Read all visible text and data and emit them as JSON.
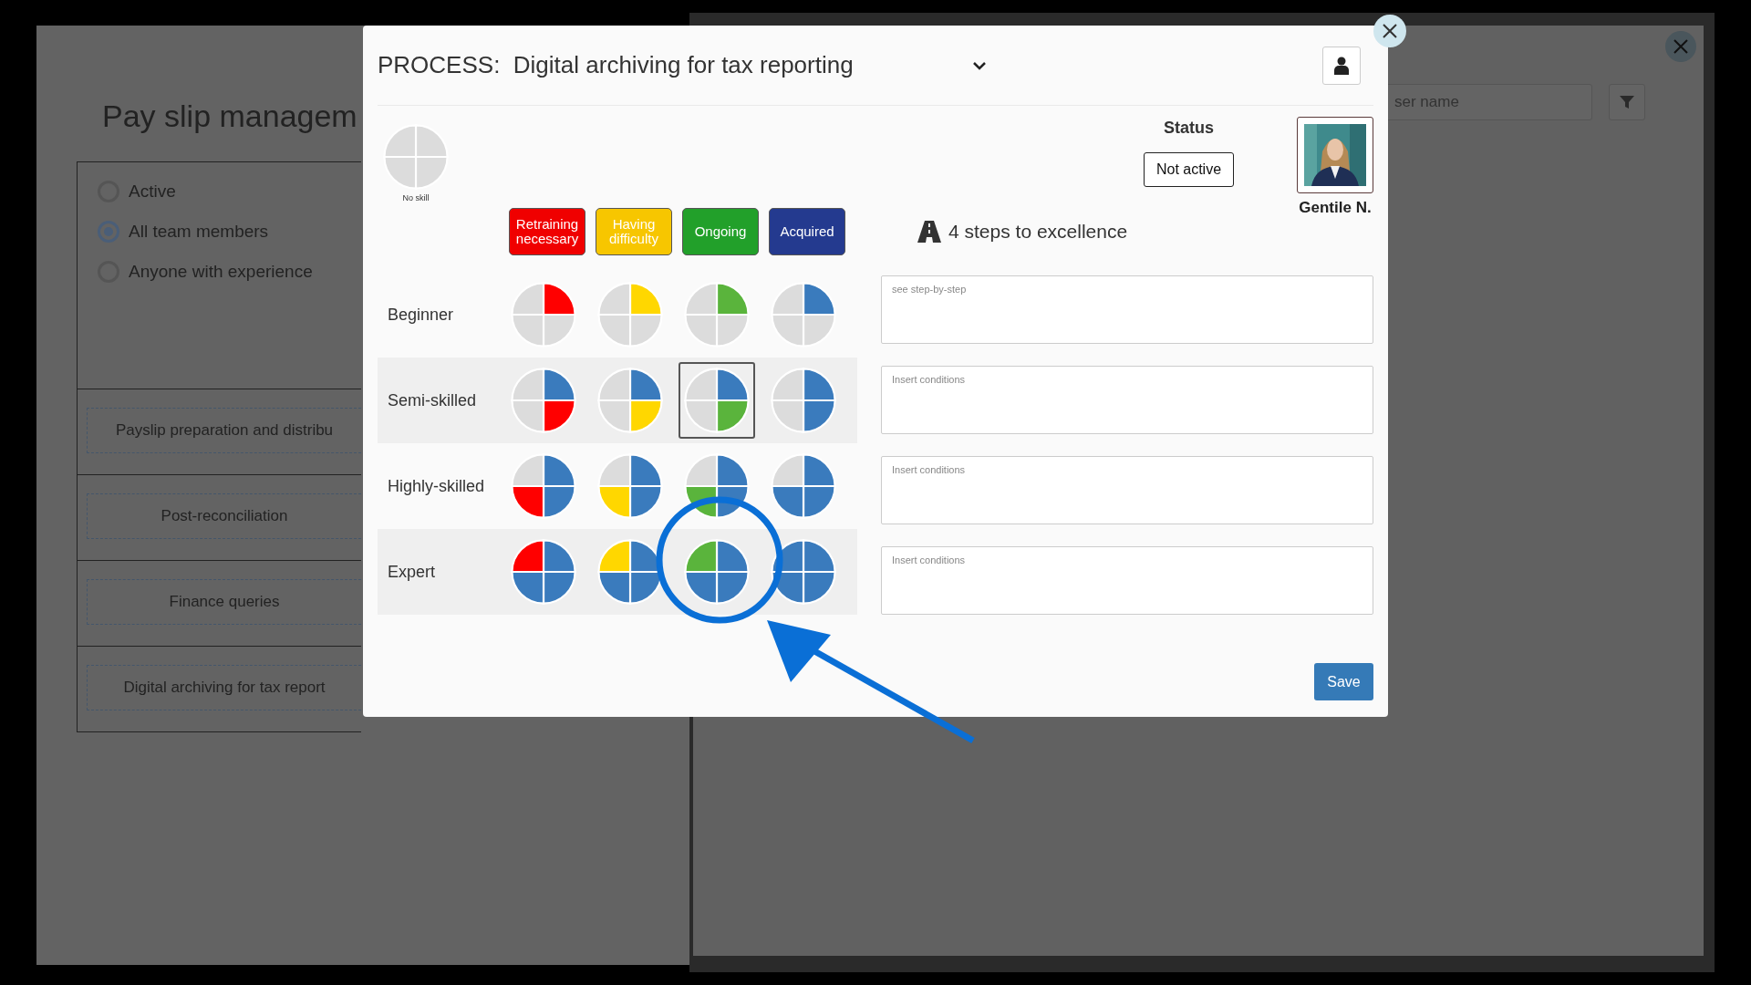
{
  "background": {
    "title": "Pay slip managem",
    "filters": [
      {
        "label": "Active",
        "selected": false
      },
      {
        "label": "All team members",
        "selected": true
      },
      {
        "label": "Anyone with experience",
        "selected": false
      }
    ],
    "processes": [
      "Payslip preparation and distribu",
      "Post-reconciliation",
      "Finance queries",
      "Digital archiving for tax report"
    ],
    "search": {
      "placeholder": "ser name"
    }
  },
  "modal": {
    "title": "PROCESS:  Digital archiving for tax reporting",
    "no_skill": {
      "label": "No skill",
      "quarters": [
        {
          "kind": "empty"
        },
        {
          "kind": "empty"
        },
        {
          "kind": "empty"
        },
        {
          "kind": "empty"
        }
      ]
    },
    "legend": [
      {
        "label": "Retraining necessary",
        "color": "#f00000"
      },
      {
        "label": "Having difficulty",
        "color": "#f7c600"
      },
      {
        "label": "Ongoing",
        "color": "#22a02a"
      },
      {
        "label": "Acquired",
        "color": "#243a8f"
      }
    ],
    "grid": {
      "rows": [
        {
          "label": "Beginner",
          "cells": [
            {
              "quarters": [
                {
                  "kind": "current"
                },
                {
                  "kind": "empty"
                },
                {
                  "kind": "empty"
                },
                {
                  "kind": "empty"
                }
              ],
              "color": "#ff0000",
              "selected": false,
              "highlighted": false
            },
            {
              "quarters": [
                {
                  "kind": "current"
                },
                {
                  "kind": "empty"
                },
                {
                  "kind": "empty"
                },
                {
                  "kind": "empty"
                }
              ],
              "color": "#ffd700",
              "selected": false,
              "highlighted": false
            },
            {
              "quarters": [
                {
                  "kind": "current"
                },
                {
                  "kind": "empty"
                },
                {
                  "kind": "empty"
                },
                {
                  "kind": "empty"
                }
              ],
              "color": "#5ab43c",
              "selected": false,
              "highlighted": false
            },
            {
              "quarters": [
                {
                  "kind": "current"
                },
                {
                  "kind": "empty"
                },
                {
                  "kind": "empty"
                },
                {
                  "kind": "empty"
                }
              ],
              "color": "#3a7bbd",
              "selected": false,
              "highlighted": false
            }
          ]
        },
        {
          "label": "Semi-skilled",
          "cells": [
            {
              "quarters": [
                {
                  "kind": "done"
                },
                {
                  "kind": "current"
                },
                {
                  "kind": "empty"
                },
                {
                  "kind": "empty"
                }
              ],
              "color": "#ff0000",
              "selected": false,
              "highlighted": false
            },
            {
              "quarters": [
                {
                  "kind": "done"
                },
                {
                  "kind": "current"
                },
                {
                  "kind": "empty"
                },
                {
                  "kind": "empty"
                }
              ],
              "color": "#ffd700",
              "selected": false,
              "highlighted": false
            },
            {
              "quarters": [
                {
                  "kind": "done"
                },
                {
                  "kind": "current"
                },
                {
                  "kind": "empty"
                },
                {
                  "kind": "empty"
                }
              ],
              "color": "#5ab43c",
              "selected": true,
              "highlighted": false
            },
            {
              "quarters": [
                {
                  "kind": "done"
                },
                {
                  "kind": "current"
                },
                {
                  "kind": "empty"
                },
                {
                  "kind": "empty"
                }
              ],
              "color": "#3a7bbd",
              "selected": false,
              "highlighted": false
            }
          ]
        },
        {
          "label": "Highly-skilled",
          "cells": [
            {
              "quarters": [
                {
                  "kind": "done"
                },
                {
                  "kind": "done"
                },
                {
                  "kind": "current"
                },
                {
                  "kind": "empty"
                }
              ],
              "color": "#ff0000",
              "selected": false,
              "highlighted": false
            },
            {
              "quarters": [
                {
                  "kind": "done"
                },
                {
                  "kind": "done"
                },
                {
                  "kind": "current"
                },
                {
                  "kind": "empty"
                }
              ],
              "color": "#ffd700",
              "selected": false,
              "highlighted": false
            },
            {
              "quarters": [
                {
                  "kind": "done"
                },
                {
                  "kind": "done"
                },
                {
                  "kind": "current"
                },
                {
                  "kind": "empty"
                }
              ],
              "color": "#5ab43c",
              "selected": false,
              "highlighted": false
            },
            {
              "quarters": [
                {
                  "kind": "done"
                },
                {
                  "kind": "done"
                },
                {
                  "kind": "current"
                },
                {
                  "kind": "empty"
                }
              ],
              "color": "#3a7bbd",
              "selected": false,
              "highlighted": false
            }
          ]
        },
        {
          "label": "Expert",
          "cells": [
            {
              "quarters": [
                {
                  "kind": "done"
                },
                {
                  "kind": "done"
                },
                {
                  "kind": "done"
                },
                {
                  "kind": "current"
                }
              ],
              "color": "#ff0000",
              "selected": false,
              "highlighted": false
            },
            {
              "quarters": [
                {
                  "kind": "done"
                },
                {
                  "kind": "done"
                },
                {
                  "kind": "done"
                },
                {
                  "kind": "current"
                }
              ],
              "color": "#ffd700",
              "selected": false,
              "highlighted": false
            },
            {
              "quarters": [
                {
                  "kind": "done"
                },
                {
                  "kind": "done"
                },
                {
                  "kind": "done"
                },
                {
                  "kind": "current"
                }
              ],
              "color": "#5ab43c",
              "selected": false,
              "highlighted": true
            },
            {
              "quarters": [
                {
                  "kind": "done"
                },
                {
                  "kind": "done"
                },
                {
                  "kind": "done"
                },
                {
                  "kind": "current"
                }
              ],
              "color": "#3a7bbd",
              "selected": false,
              "highlighted": false
            }
          ]
        }
      ]
    },
    "status": {
      "label": "Status",
      "value": "Not active"
    },
    "person": {
      "name": "Gentile N."
    },
    "steps_heading": "4 steps to excellence",
    "fields": [
      {
        "placeholder": "see step-by-step"
      },
      {
        "placeholder": "Insert conditions"
      },
      {
        "placeholder": "Insert conditions"
      },
      {
        "placeholder": "Insert conditions"
      }
    ],
    "save": "Save"
  }
}
